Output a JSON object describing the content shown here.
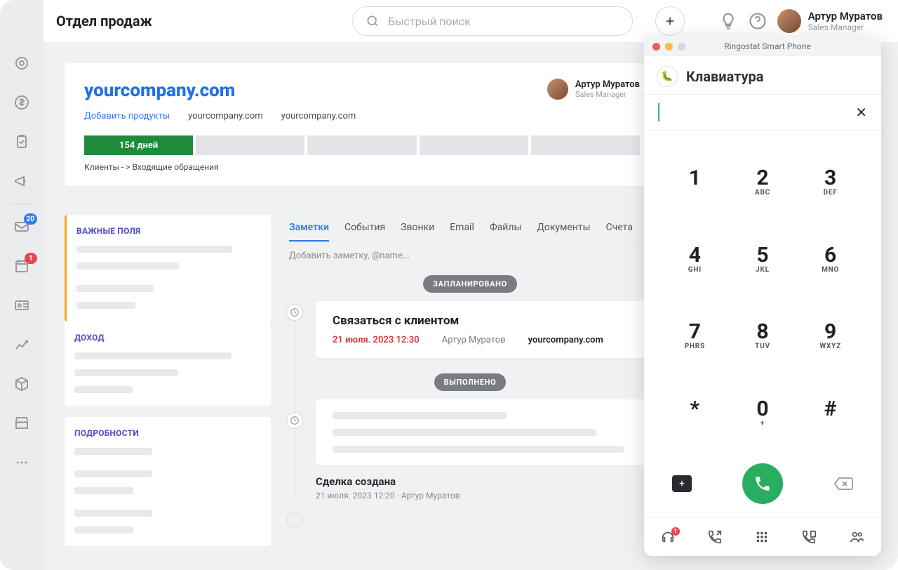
{
  "header": {
    "title": "Отдел продаж",
    "search_placeholder": "Быстрый поиск",
    "user_name": "Артур Муратов",
    "user_role": "Sales Manager"
  },
  "rail": {
    "mail_badge": "20",
    "cal_badge": "1"
  },
  "deal": {
    "title": "yourcompany.com",
    "add_products": "Добавить продукты",
    "company1": "yourcompany.com",
    "company2": "yourcompany.com",
    "stage_label": "154 дней",
    "breadcrumb": "Клиенты - > Входящие обращения",
    "owner_name": "Артур Муратов",
    "owner_role": "Sales Manager"
  },
  "panels": {
    "important": "ВАЖНЫЕ ПОЛЯ",
    "income": "ДОХОД",
    "details": "ПОДРОБНОСТИ"
  },
  "tabs": {
    "notes": "Заметки",
    "events": "События",
    "calls": "Звонки",
    "email": "Email",
    "files": "Файлы",
    "docs": "Документы",
    "bills": "Счета",
    "note_placeholder": "Добавить заметку, @name..."
  },
  "timeline": {
    "planned": "ЗАПЛАНИРОВАНО",
    "done": "ВЫПОЛНЕНО",
    "task_title": "Связаться с клиентом",
    "task_due": "21 июля. 2023 12:30",
    "task_owner": "Артур Муратов",
    "task_company": "yourcompany.com",
    "created_title": "Сделка создана",
    "created_sub": "21 июля. 2023 12:20 · Артур Муратов"
  },
  "phone": {
    "window_title": "Ringostat Smart Phone",
    "title": "Клавиатура",
    "keys": [
      {
        "d": "1",
        "l": ""
      },
      {
        "d": "2",
        "l": "ABC"
      },
      {
        "d": "3",
        "l": "DEF"
      },
      {
        "d": "4",
        "l": "GHI"
      },
      {
        "d": "5",
        "l": "JKL"
      },
      {
        "d": "6",
        "l": "MNO"
      },
      {
        "d": "7",
        "l": "PHRS"
      },
      {
        "d": "8",
        "l": "TUV"
      },
      {
        "d": "9",
        "l": "WXYZ"
      },
      {
        "d": "*",
        "l": ""
      },
      {
        "d": "0",
        "l": "+"
      },
      {
        "d": "#",
        "l": ""
      }
    ],
    "nav_badge": "1"
  }
}
